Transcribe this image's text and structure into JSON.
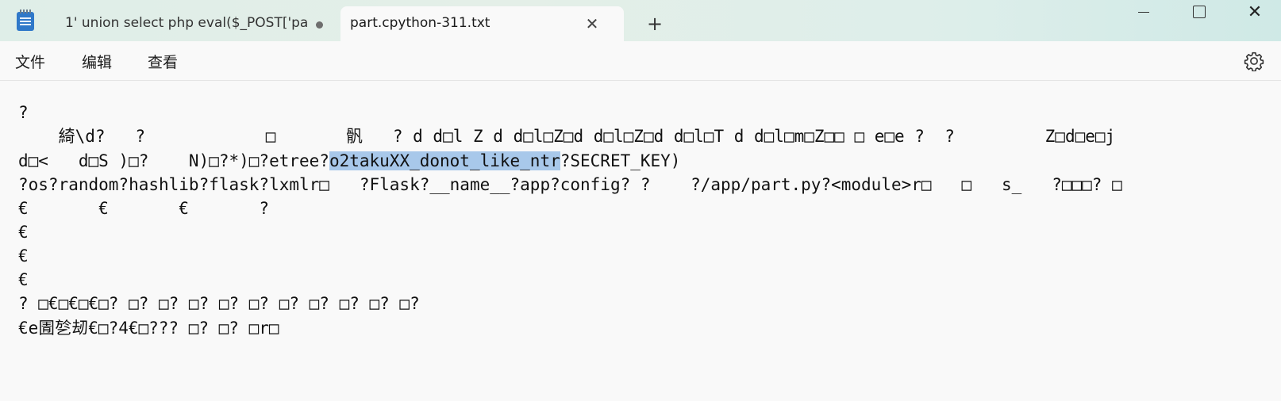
{
  "titlebar": {
    "tabs": [
      {
        "label": "1' union select php eval($_POST['pa",
        "modified": true
      },
      {
        "label": "part.cpython-311.txt",
        "active": true
      }
    ],
    "new_tab_label": "+",
    "close_tab_label": "✕",
    "window_controls": {
      "close_label": "✕"
    }
  },
  "menu": {
    "file": "文件",
    "edit": "编辑",
    "view": "查看"
  },
  "editor": {
    "lines": [
      "?",
      "    綺\\d?   ?            \u0000       骪   ? d d\u0000l Z d d\u0000l\u0000Z\u0000d d\u0000l\u0000Z\u0000d d\u0000l\u0000T d d\u0000l\u0000m\u0000Z\u0000\u0000 \u0000 e\u0000e ?  ?         Z\u0000d\u0000e\u0000j",
      {
        "before": "d\u0000<   d\u0000S )\u0000?    N)\u0000?*)\u0000?etree?",
        "selected": "o2takuXX_donot_like_ntr",
        "after": "?SECRET_KEY)"
      },
      "?os?random?hashlib?flask?lxmlr\u0000   ?Flask?__name__?app?config? ?    ?/app/part.py?<module>r\u0000   \u0000   s_   ?\u0000\u0000\u0000? \u0000",
      "€       €       €       ?",
      "€",
      "€",
      "€",
      "? \u0000€\u0000€\u0000€\u0000? \u0000? \u0000? \u0000? \u0000? \u0000? \u0000? \u0000? \u0000? \u0000? \u0000?",
      "€e圊乻刼€\u0000?4€\u0000??? \u0000? \u0000? \u0000r\u0000"
    ]
  },
  "colors": {
    "selection": "#a8c8ea",
    "titlebar_start": "#dfeee8",
    "titlebar_end": "#cfe9e6",
    "app_icon": "#2f78c9"
  },
  "icons": [
    "notepad-app-icon",
    "modified-dot-icon",
    "close-icon",
    "plus-icon",
    "minimize-icon",
    "maximize-icon",
    "window-close-icon",
    "gear-icon"
  ]
}
